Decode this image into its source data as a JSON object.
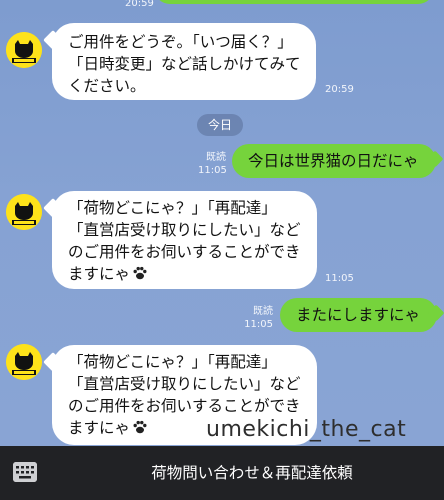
{
  "chat": {
    "top_timestamp": "20:59",
    "messages": [
      {
        "lines": [
          "ご用件をどうぞ。「いつ届く？」",
          "「日時変更」など話しかけてみて",
          "ください。"
        ],
        "time": "20:59"
      },
      {
        "lines": [
          "「荷物どこにゃ？」「再配達」",
          "「直営店受け取りにしたい」など",
          "のご用件をお伺いすることができ",
          "ますにゃ"
        ],
        "time": "11:05"
      },
      {
        "lines": [
          "「荷物どこにゃ？」「再配達」",
          "「直営店受け取りにしたい」など",
          "のご用件をお伺いすることができ",
          "ますにゃ"
        ]
      }
    ],
    "date_separator": "今日",
    "sent": [
      {
        "text": "今日は世界猫の日だにゃ",
        "read": "既読",
        "time": "11:05"
      },
      {
        "text": "またにしますにゃ",
        "read": "既読",
        "time": "11:05"
      }
    ]
  },
  "watermark": "umekichi_the_cat",
  "menu": {
    "label": "荷物問い合わせ＆再配達依頼",
    "keyboard_icon": "keyboard-icon"
  },
  "colors": {
    "sent_bubble": "#76d33c",
    "received_bubble": "#ffffff",
    "menu_bar": "#212225",
    "avatar": "#fde21a"
  }
}
